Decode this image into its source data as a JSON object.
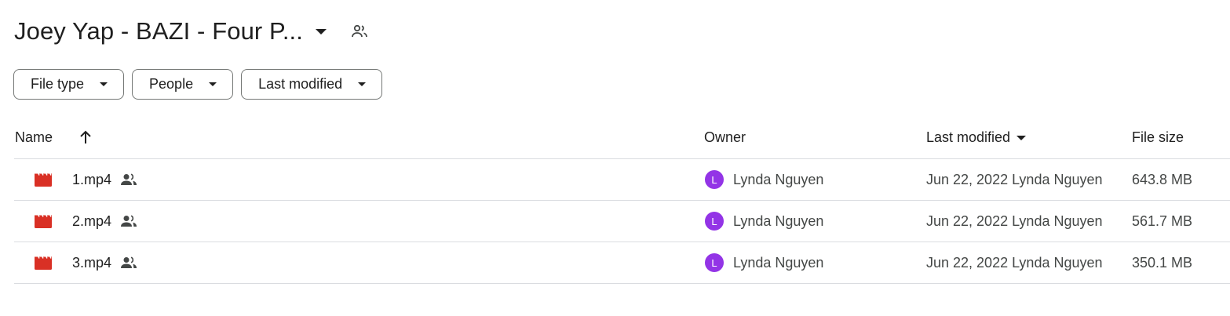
{
  "header": {
    "folder_title": "Joey Yap - BAZI - Four P..."
  },
  "filters": [
    {
      "label": "File type"
    },
    {
      "label": "People"
    },
    {
      "label": "Last modified"
    }
  ],
  "table": {
    "columns": {
      "name": "Name",
      "owner": "Owner",
      "last_modified": "Last modified",
      "file_size": "File size"
    },
    "sort": {
      "name_direction": "ascending",
      "last_modified_direction": "descending"
    },
    "rows": [
      {
        "name": "1.mp4",
        "icon": "video-file-icon",
        "shared": true,
        "owner_initial": "L",
        "owner": "Lynda Nguyen",
        "modified": "Jun 22, 2022 Lynda Nguyen",
        "size": "643.8 MB"
      },
      {
        "name": "2.mp4",
        "icon": "video-file-icon",
        "shared": true,
        "owner_initial": "L",
        "owner": "Lynda Nguyen",
        "modified": "Jun 22, 2022 Lynda Nguyen",
        "size": "561.7 MB"
      },
      {
        "name": "3.mp4",
        "icon": "video-file-icon",
        "shared": true,
        "owner_initial": "L",
        "owner": "Lynda Nguyen",
        "modified": "Jun 22, 2022 Lynda Nguyen",
        "size": "350.1 MB"
      }
    ]
  },
  "colors": {
    "video_icon": "#d93025",
    "avatar": "#9334e6",
    "divider": "#dadce0",
    "chip_border": "#747775"
  }
}
